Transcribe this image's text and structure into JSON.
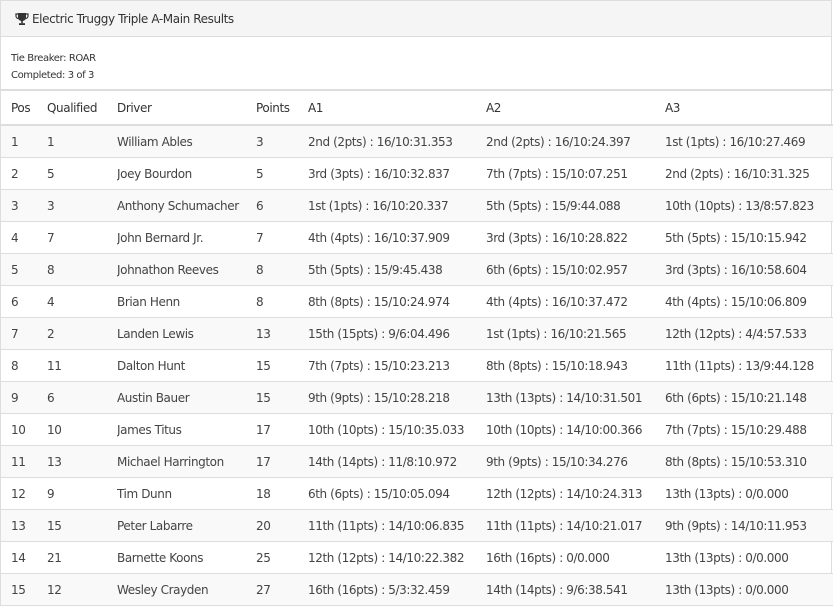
{
  "panel": {
    "title": "Electric Truggy Triple A-Main Results",
    "icon": "trophy-icon",
    "tie_breaker": "Tie Breaker: ROAR",
    "completed": "Completed: 3 of 3"
  },
  "table": {
    "headers": [
      "Pos",
      "Qualified",
      "Driver",
      "Points",
      "A1",
      "A2",
      "A3"
    ],
    "rows": [
      [
        "1",
        "1",
        "William Ables",
        "3",
        "2nd (2pts) : 16/10:31.353",
        "2nd (2pts) : 16/10:24.397",
        "1st (1pts) : 16/10:27.469"
      ],
      [
        "2",
        "5",
        "Joey Bourdon",
        "5",
        "3rd (3pts) : 16/10:32.837",
        "7th (7pts) : 15/10:07.251",
        "2nd (2pts) : 16/10:31.325"
      ],
      [
        "3",
        "3",
        "Anthony Schumacher",
        "6",
        "1st (1pts) : 16/10:20.337",
        "5th (5pts) : 15/9:44.088",
        "10th (10pts) : 13/8:57.823"
      ],
      [
        "4",
        "7",
        "John Bernard Jr.",
        "7",
        "4th (4pts) : 16/10:37.909",
        "3rd (3pts) : 16/10:28.822",
        "5th (5pts) : 15/10:15.942"
      ],
      [
        "5",
        "8",
        "Johnathon Reeves",
        "8",
        "5th (5pts) : 15/9:45.438",
        "6th (6pts) : 15/10:02.957",
        "3rd (3pts) : 16/10:58.604"
      ],
      [
        "6",
        "4",
        "Brian Henn",
        "8",
        "8th (8pts) : 15/10:24.974",
        "4th (4pts) : 16/10:37.472",
        "4th (4pts) : 15/10:06.809"
      ],
      [
        "7",
        "2",
        "Landen Lewis",
        "13",
        "15th (15pts) : 9/6:04.496",
        "1st (1pts) : 16/10:21.565",
        "12th (12pts) : 4/4:57.533"
      ],
      [
        "8",
        "11",
        "Dalton Hunt",
        "15",
        "7th (7pts) : 15/10:23.213",
        "8th (8pts) : 15/10:18.943",
        "11th (11pts) : 13/9:44.128"
      ],
      [
        "9",
        "6",
        "Austin Bauer",
        "15",
        "9th (9pts) : 15/10:28.218",
        "13th (13pts) : 14/10:31.501",
        "6th (6pts) : 15/10:21.148"
      ],
      [
        "10",
        "10",
        "James Titus",
        "17",
        "10th (10pts) : 15/10:35.033",
        "10th (10pts) : 14/10:00.366",
        "7th (7pts) : 15/10:29.488"
      ],
      [
        "11",
        "13",
        "Michael Harrington",
        "17",
        "14th (14pts) : 11/8:10.972",
        "9th (9pts) : 15/10:34.276",
        "8th (8pts) : 15/10:53.310"
      ],
      [
        "12",
        "9",
        "Tim Dunn",
        "18",
        "6th (6pts) : 15/10:05.094",
        "12th (12pts) : 14/10:24.313",
        "13th (13pts) : 0/0.000"
      ],
      [
        "13",
        "15",
        "Peter Labarre",
        "20",
        "11th (11pts) : 14/10:06.835",
        "11th (11pts) : 14/10:21.017",
        "9th (9pts) : 14/10:11.953"
      ],
      [
        "14",
        "21",
        "Barnette Koons",
        "25",
        "12th (12pts) : 14/10:22.382",
        "16th (16pts) : 0/0.000",
        "13th (13pts) : 0/0.000"
      ],
      [
        "15",
        "12",
        "Wesley Crayden",
        "27",
        "16th (16pts) : 5/3:32.459",
        "14th (14pts) : 9/6:38.541",
        "13th (13pts) : 0/0.000"
      ]
    ]
  }
}
